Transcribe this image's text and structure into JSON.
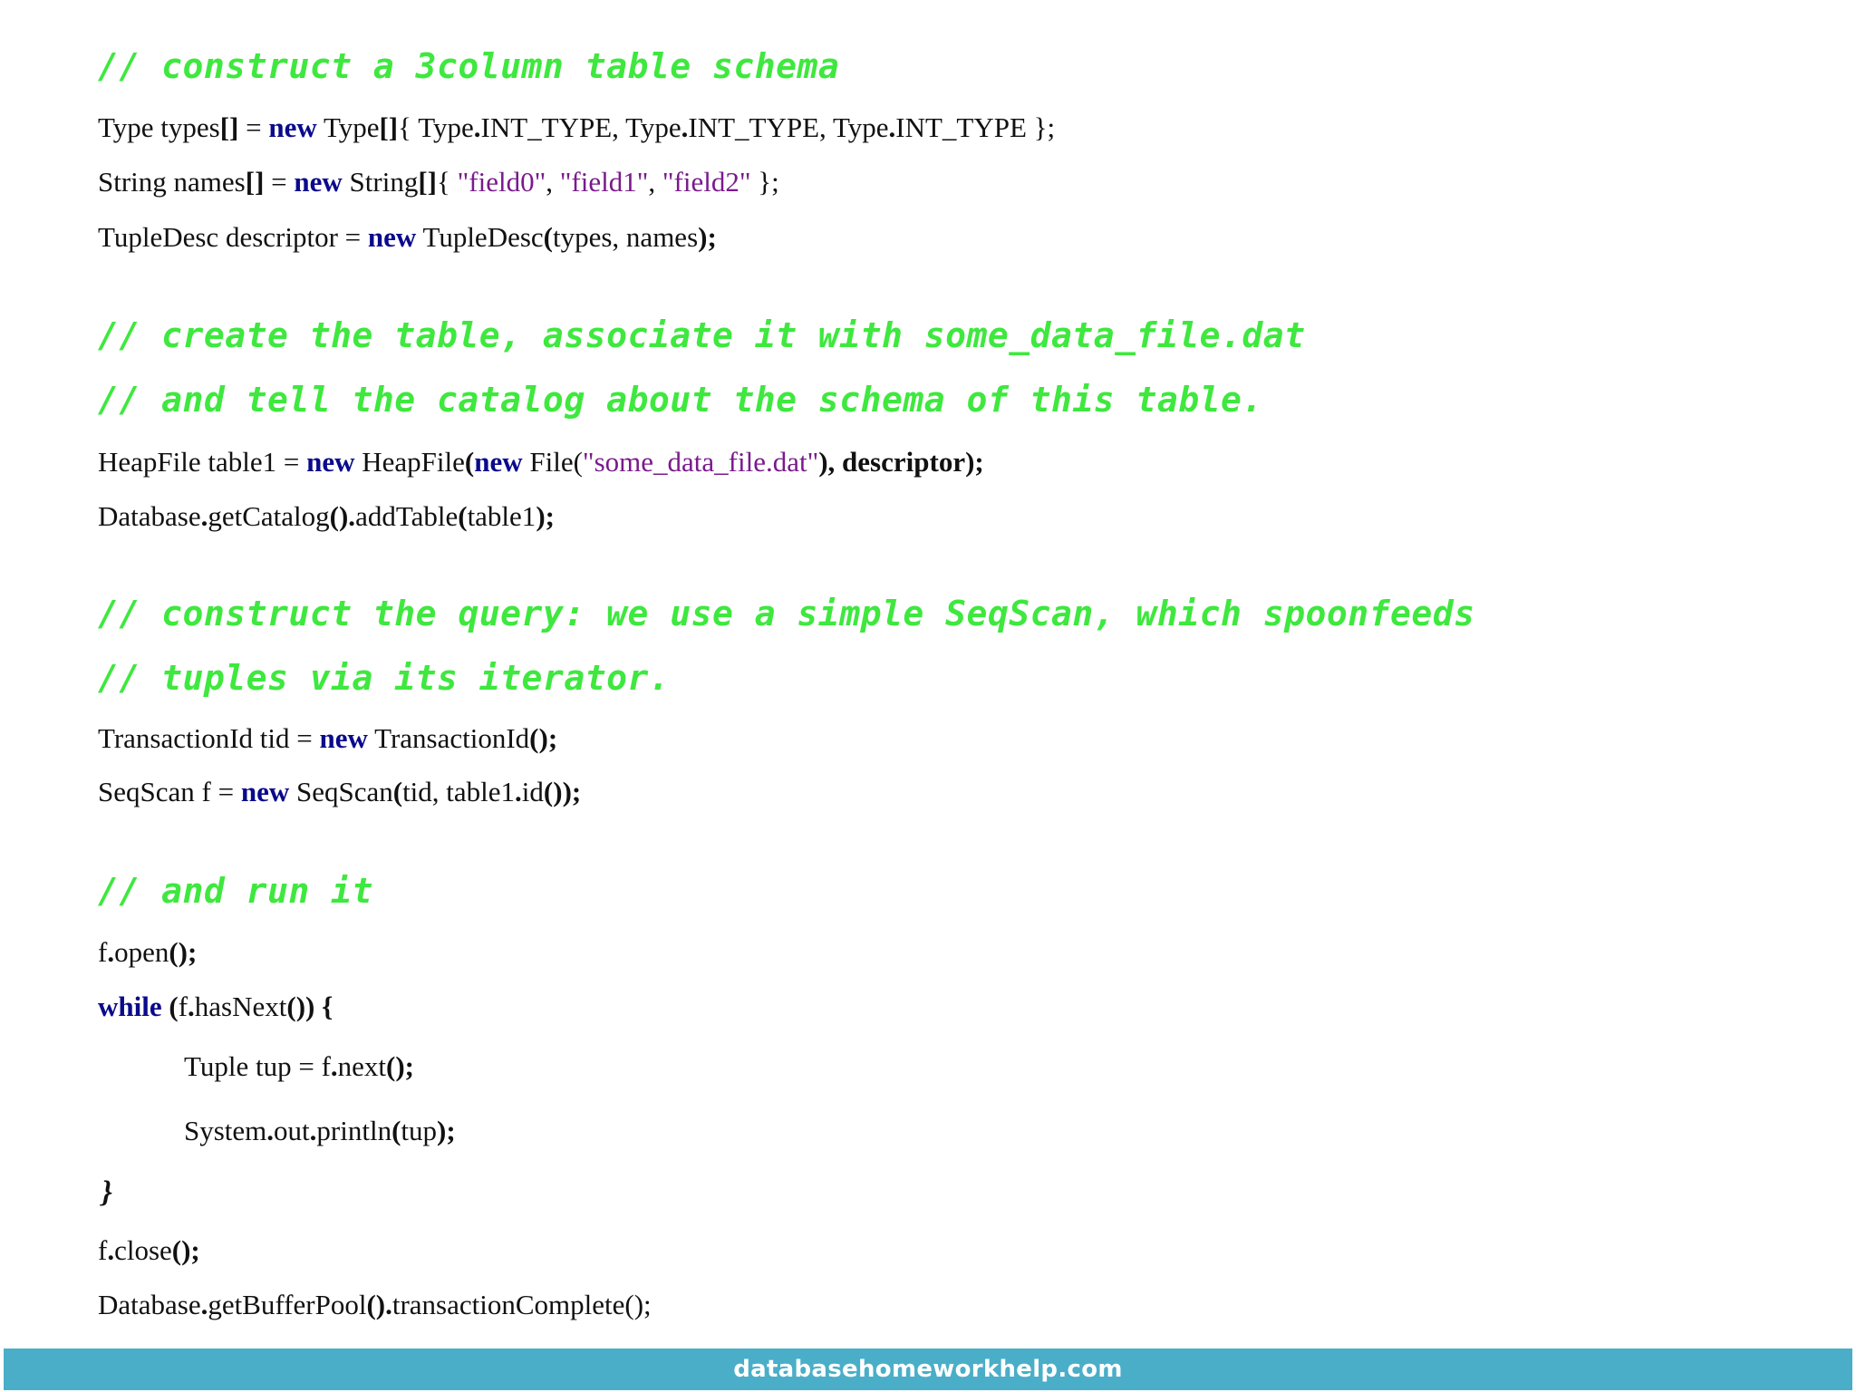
{
  "comments": {
    "c1": "// construct a 3column table schema",
    "c2": "// create the table, associate it with some_data_file.dat",
    "c3": "// and tell the catalog about the schema of this table.",
    "c4": "// construct the query: we use a simple SeqScan, which spoonfeeds",
    "c5": "// tuples via its iterator.",
    "c6": "// and run it"
  },
  "code": {
    "types_a": "Type types",
    "types_b": "[]",
    "types_c": " = ",
    "types_kw": "new",
    "types_d": " Type",
    "types_e": "[]",
    "types_f": "{ Type",
    "types_g": ".",
    "types_h": "INT_TYPE, Type",
    "types_i": ".",
    "types_j": "INT_TYPE, Type",
    "types_k": ".",
    "types_l": "INT_TYPE };",
    "names_a": "String names",
    "names_b": "[]",
    "names_c": " = ",
    "names_kw": "new",
    "names_d": " String",
    "names_e": "[]",
    "names_f": "{ ",
    "names_s1": "\"field0\"",
    "names_g": ", ",
    "names_s2": "\"field1\"",
    "names_h": ", ",
    "names_s3": "\"field2\"",
    "names_i": " };",
    "desc_a": "TupleDesc descriptor = ",
    "desc_kw": "new",
    "desc_b": " TupleDesc",
    "desc_c": "(",
    "desc_d": "types, names",
    "desc_e": ");",
    "heap_a": "HeapFile table1 = ",
    "heap_kw1": "new",
    "heap_b": " HeapFile",
    "heap_c": "(",
    "heap_kw2": "new",
    "heap_d": " File",
    "heap_e": "(",
    "heap_s": "\"some_data_file.dat\"",
    "heap_f": "), descriptor);",
    "db1_a": "Database",
    "db1_b": ".",
    "db1_c": "getCatalog",
    "db1_d": "().",
    "db1_e": "addTable",
    "db1_f": "(",
    "db1_g": "table1",
    "db1_h": ");",
    "tid_a": "TransactionId tid = ",
    "tid_kw": "new",
    "tid_b": " TransactionId",
    "tid_c": "();",
    "seq_a": "SeqScan f = ",
    "seq_kw": "new",
    "seq_b": " SeqScan",
    "seq_c": "(",
    "seq_d": "tid, table1",
    "seq_e": ".",
    "seq_f": "id",
    "seq_g": "());",
    "open_a": "f",
    "open_b": ".",
    "open_c": "open",
    "open_d": "();",
    "while_kw": "while",
    "while_a": " (",
    "while_b": "f",
    "while_c": ".",
    "while_d": "hasNext",
    "while_e": "()) {",
    "tup_a": "Tuple tup = f",
    "tup_b": ".",
    "tup_c": "next",
    "tup_d": "();",
    "sys_a": "System",
    "sys_b": ".",
    "sys_c": "out",
    "sys_d": ".",
    "sys_e": "println",
    "sys_f": "(",
    "sys_g": "tup",
    "sys_h": ");",
    "brace": "}",
    "close_a": "f",
    "close_b": ".",
    "close_c": "close",
    "close_d": "();",
    "db2_a": "Database",
    "db2_b": ".",
    "db2_c": "getBufferPool",
    "db2_d": "().",
    "db2_e": "transactionComplete();"
  },
  "footer": {
    "text": "databasehomeworkhelp.com"
  },
  "colors": {
    "comment": "#3ee83e",
    "keyword": "#0a0a8c",
    "string": "#7a1a8c",
    "footer_bg": "#4aaec8"
  }
}
